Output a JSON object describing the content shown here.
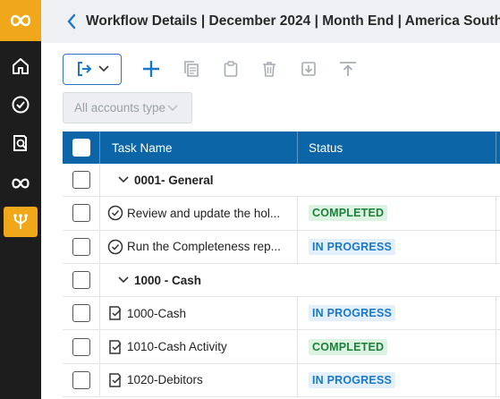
{
  "sidebar": {
    "logo": "infinity-logo",
    "items": [
      {
        "icon": "home-icon",
        "active": false
      },
      {
        "icon": "check-circle-icon",
        "active": false
      },
      {
        "icon": "document-search-icon",
        "active": false
      },
      {
        "icon": "infinity-icon",
        "active": false
      },
      {
        "icon": "workflow-icon",
        "active": true
      }
    ],
    "accent": "#f0a71a"
  },
  "header": {
    "title": "Workflow Details | December 2024 | Month End | America South"
  },
  "toolbar": {
    "icons": [
      "export-icon",
      "add-icon",
      "copy-icon",
      "clipboard-icon",
      "delete-icon",
      "download-icon",
      "upload-icon"
    ]
  },
  "filter": {
    "value": "All accounts type"
  },
  "table": {
    "columns": [
      "Task Name",
      "Status"
    ],
    "header_color": "#0c65a6",
    "rows": [
      {
        "type": "group",
        "name": "0001- General"
      },
      {
        "type": "task",
        "icon": "check-circle-icon",
        "name": "Review and update the hol...",
        "status": "COMPLETED"
      },
      {
        "type": "task",
        "icon": "check-circle-icon",
        "name": "Run the Completeness rep...",
        "status": "IN PROGRESS"
      },
      {
        "type": "group",
        "name": "1000 - Cash"
      },
      {
        "type": "task",
        "icon": "reconciliation-icon",
        "name": "1000-Cash",
        "status": "IN PROGRESS"
      },
      {
        "type": "task",
        "icon": "reconciliation-icon",
        "name": "1010-Cash Activity",
        "status": "COMPLETED"
      },
      {
        "type": "task",
        "icon": "reconciliation-icon",
        "name": "1020-Debitors",
        "status": "IN PROGRESS"
      }
    ]
  },
  "status_colors": {
    "COMPLETED": {
      "fg": "#1e7f3a",
      "bg": "#dcf3e2"
    },
    "IN PROGRESS": {
      "fg": "#1a78c8",
      "bg": "#e3f0fb"
    }
  }
}
